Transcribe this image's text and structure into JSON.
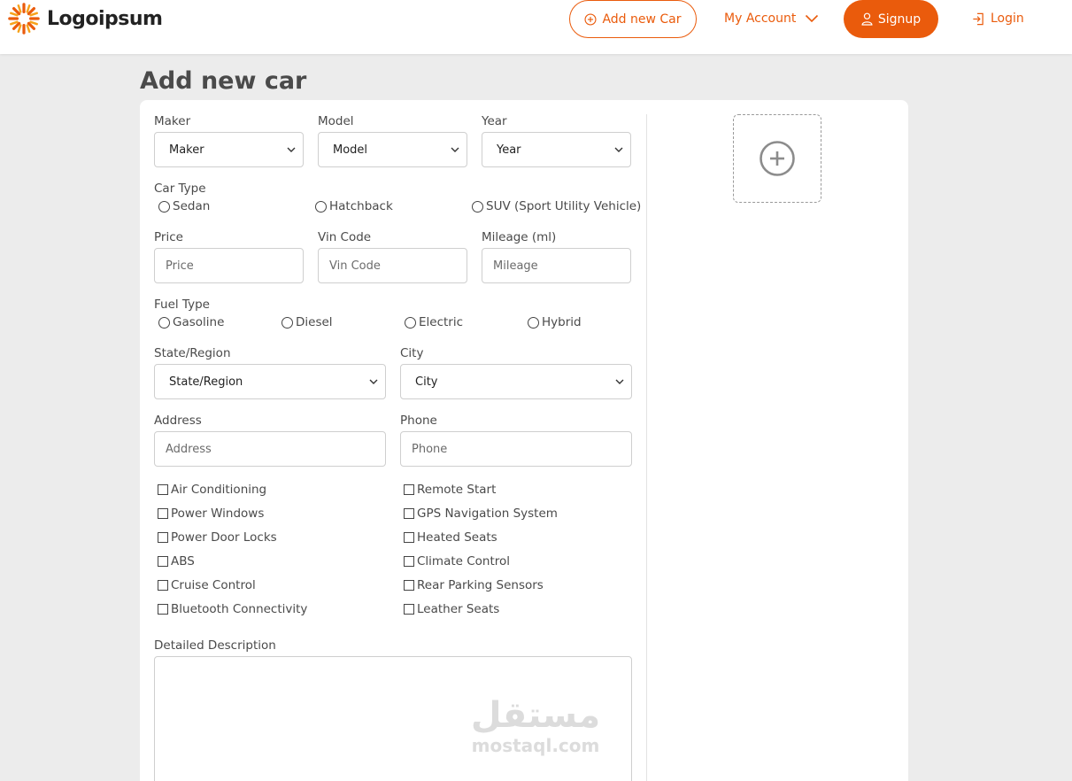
{
  "header": {
    "logo_text": "Logoipsum",
    "add_new_car_label": "Add new Car",
    "my_account_label": "My Account",
    "signup_label": "Signup",
    "login_label": "Login"
  },
  "page": {
    "title": "Add new car"
  },
  "form": {
    "maker": {
      "label": "Maker",
      "value": "Maker"
    },
    "model": {
      "label": "Model",
      "value": "Model"
    },
    "year": {
      "label": "Year",
      "value": "Year"
    },
    "car_type": {
      "label": "Car Type",
      "options": [
        "Sedan",
        "Hatchback",
        "SUV (Sport Utility Vehicle)"
      ]
    },
    "price": {
      "label": "Price",
      "placeholder": "Price"
    },
    "vin_code": {
      "label": "Vin Code",
      "placeholder": "Vin Code"
    },
    "mileage": {
      "label": "Mileage (ml)",
      "placeholder": "Mileage"
    },
    "fuel_type": {
      "label": "Fuel Type",
      "options": [
        "Gasoline",
        "Diesel",
        "Electric",
        "Hybrid"
      ]
    },
    "state_region": {
      "label": "State/Region",
      "value": "State/Region"
    },
    "city": {
      "label": "City",
      "value": "City"
    },
    "address": {
      "label": "Address",
      "placeholder": "Address"
    },
    "phone": {
      "label": "Phone",
      "placeholder": "Phone"
    },
    "features_left": [
      "Air Conditioning",
      "Power Windows",
      "Power Door Locks",
      "ABS",
      "Cruise Control",
      "Bluetooth Connectivity"
    ],
    "features_right": [
      "Remote Start",
      "GPS Navigation System",
      "Heated Seats",
      "Climate Control",
      "Rear Parking Sensors",
      "Leather Seats"
    ],
    "description": {
      "label": "Detailed Description"
    }
  },
  "watermark": {
    "arabic": "مستقل",
    "latin": "mostaql.com"
  },
  "colors": {
    "accent": "#ea5b0c",
    "background": "#ececec",
    "card": "#ffffff"
  },
  "icons": {
    "logo": "sunburst-logo-icon",
    "add": "plus-circle-icon",
    "account": "chevron-down-icon",
    "signup": "user-icon",
    "login": "login-icon",
    "select": "chevron-down-icon",
    "upload": "plus-circle-icon"
  }
}
